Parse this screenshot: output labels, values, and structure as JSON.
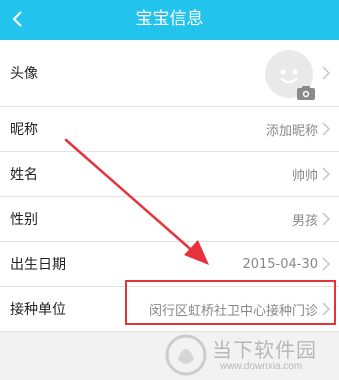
{
  "header": {
    "title": "宝宝信息"
  },
  "rows": [
    {
      "label": "头像"
    },
    {
      "label": "昵称",
      "value": "添加昵称"
    },
    {
      "label": "姓名",
      "value": "帅帅"
    },
    {
      "label": "性别",
      "value": "男孩"
    },
    {
      "label": "出生日期",
      "value": "2015-04-30"
    },
    {
      "label": "接种单位",
      "value": "闵行区虹桥社卫中心接种门诊"
    }
  ],
  "watermark": {
    "cn": "当下软件园",
    "en": "www.downxia.com"
  },
  "colors": {
    "header_bg": "#22c4ee",
    "highlight": "#e8323b"
  }
}
